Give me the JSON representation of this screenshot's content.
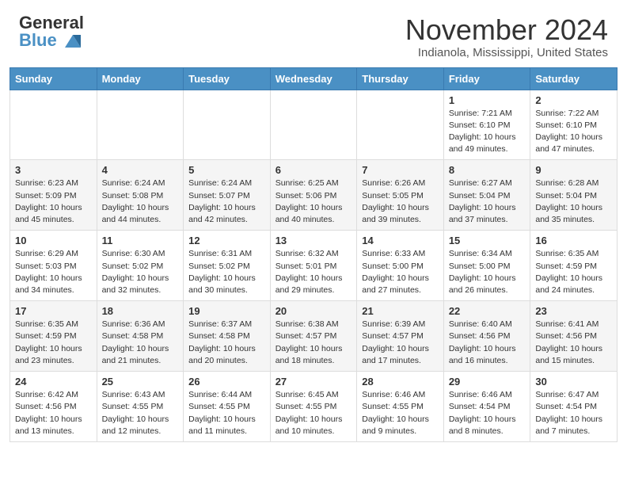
{
  "header": {
    "logo_line1": "General",
    "logo_line2": "Blue",
    "month": "November 2024",
    "location": "Indianola, Mississippi, United States"
  },
  "days_of_week": [
    "Sunday",
    "Monday",
    "Tuesday",
    "Wednesday",
    "Thursday",
    "Friday",
    "Saturday"
  ],
  "weeks": [
    [
      {
        "day": "",
        "info": ""
      },
      {
        "day": "",
        "info": ""
      },
      {
        "day": "",
        "info": ""
      },
      {
        "day": "",
        "info": ""
      },
      {
        "day": "",
        "info": ""
      },
      {
        "day": "1",
        "info": "Sunrise: 7:21 AM\nSunset: 6:10 PM\nDaylight: 10 hours\nand 49 minutes."
      },
      {
        "day": "2",
        "info": "Sunrise: 7:22 AM\nSunset: 6:10 PM\nDaylight: 10 hours\nand 47 minutes."
      }
    ],
    [
      {
        "day": "3",
        "info": "Sunrise: 6:23 AM\nSunset: 5:09 PM\nDaylight: 10 hours\nand 45 minutes."
      },
      {
        "day": "4",
        "info": "Sunrise: 6:24 AM\nSunset: 5:08 PM\nDaylight: 10 hours\nand 44 minutes."
      },
      {
        "day": "5",
        "info": "Sunrise: 6:24 AM\nSunset: 5:07 PM\nDaylight: 10 hours\nand 42 minutes."
      },
      {
        "day": "6",
        "info": "Sunrise: 6:25 AM\nSunset: 5:06 PM\nDaylight: 10 hours\nand 40 minutes."
      },
      {
        "day": "7",
        "info": "Sunrise: 6:26 AM\nSunset: 5:05 PM\nDaylight: 10 hours\nand 39 minutes."
      },
      {
        "day": "8",
        "info": "Sunrise: 6:27 AM\nSunset: 5:04 PM\nDaylight: 10 hours\nand 37 minutes."
      },
      {
        "day": "9",
        "info": "Sunrise: 6:28 AM\nSunset: 5:04 PM\nDaylight: 10 hours\nand 35 minutes."
      }
    ],
    [
      {
        "day": "10",
        "info": "Sunrise: 6:29 AM\nSunset: 5:03 PM\nDaylight: 10 hours\nand 34 minutes."
      },
      {
        "day": "11",
        "info": "Sunrise: 6:30 AM\nSunset: 5:02 PM\nDaylight: 10 hours\nand 32 minutes."
      },
      {
        "day": "12",
        "info": "Sunrise: 6:31 AM\nSunset: 5:02 PM\nDaylight: 10 hours\nand 30 minutes."
      },
      {
        "day": "13",
        "info": "Sunrise: 6:32 AM\nSunset: 5:01 PM\nDaylight: 10 hours\nand 29 minutes."
      },
      {
        "day": "14",
        "info": "Sunrise: 6:33 AM\nSunset: 5:00 PM\nDaylight: 10 hours\nand 27 minutes."
      },
      {
        "day": "15",
        "info": "Sunrise: 6:34 AM\nSunset: 5:00 PM\nDaylight: 10 hours\nand 26 minutes."
      },
      {
        "day": "16",
        "info": "Sunrise: 6:35 AM\nSunset: 4:59 PM\nDaylight: 10 hours\nand 24 minutes."
      }
    ],
    [
      {
        "day": "17",
        "info": "Sunrise: 6:35 AM\nSunset: 4:59 PM\nDaylight: 10 hours\nand 23 minutes."
      },
      {
        "day": "18",
        "info": "Sunrise: 6:36 AM\nSunset: 4:58 PM\nDaylight: 10 hours\nand 21 minutes."
      },
      {
        "day": "19",
        "info": "Sunrise: 6:37 AM\nSunset: 4:58 PM\nDaylight: 10 hours\nand 20 minutes."
      },
      {
        "day": "20",
        "info": "Sunrise: 6:38 AM\nSunset: 4:57 PM\nDaylight: 10 hours\nand 18 minutes."
      },
      {
        "day": "21",
        "info": "Sunrise: 6:39 AM\nSunset: 4:57 PM\nDaylight: 10 hours\nand 17 minutes."
      },
      {
        "day": "22",
        "info": "Sunrise: 6:40 AM\nSunset: 4:56 PM\nDaylight: 10 hours\nand 16 minutes."
      },
      {
        "day": "23",
        "info": "Sunrise: 6:41 AM\nSunset: 4:56 PM\nDaylight: 10 hours\nand 15 minutes."
      }
    ],
    [
      {
        "day": "24",
        "info": "Sunrise: 6:42 AM\nSunset: 4:56 PM\nDaylight: 10 hours\nand 13 minutes."
      },
      {
        "day": "25",
        "info": "Sunrise: 6:43 AM\nSunset: 4:55 PM\nDaylight: 10 hours\nand 12 minutes."
      },
      {
        "day": "26",
        "info": "Sunrise: 6:44 AM\nSunset: 4:55 PM\nDaylight: 10 hours\nand 11 minutes."
      },
      {
        "day": "27",
        "info": "Sunrise: 6:45 AM\nSunset: 4:55 PM\nDaylight: 10 hours\nand 10 minutes."
      },
      {
        "day": "28",
        "info": "Sunrise: 6:46 AM\nSunset: 4:55 PM\nDaylight: 10 hours\nand 9 minutes."
      },
      {
        "day": "29",
        "info": "Sunrise: 6:46 AM\nSunset: 4:54 PM\nDaylight: 10 hours\nand 8 minutes."
      },
      {
        "day": "30",
        "info": "Sunrise: 6:47 AM\nSunset: 4:54 PM\nDaylight: 10 hours\nand 7 minutes."
      }
    ]
  ]
}
